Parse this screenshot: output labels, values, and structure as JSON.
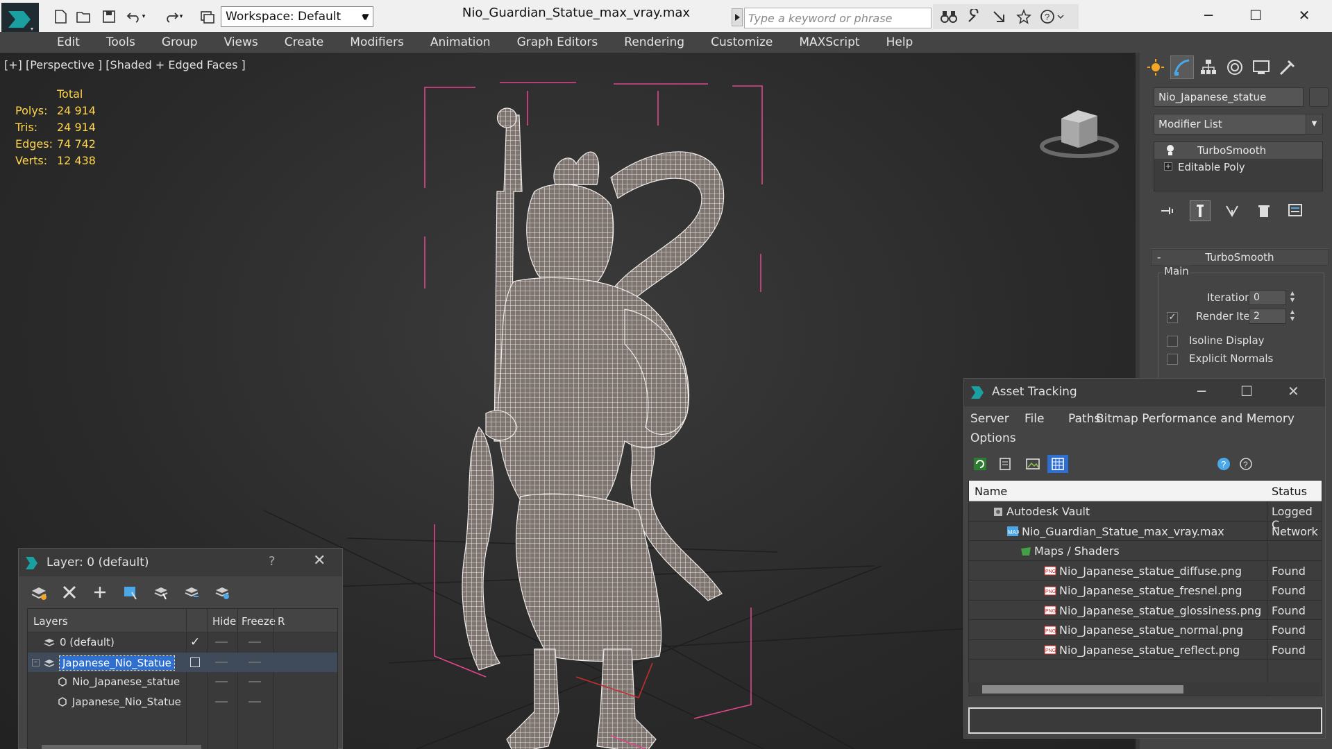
{
  "titlebar": {
    "workspace_label": "Workspace: Default",
    "document_title": "Nio_Guardian_Statue_max_vray.max",
    "search_placeholder": "Type a keyword or phrase"
  },
  "menu": [
    "Edit",
    "Tools",
    "Group",
    "Views",
    "Create",
    "Modifiers",
    "Animation",
    "Graph Editors",
    "Rendering",
    "Customize",
    "MAXScript",
    "Help"
  ],
  "viewport": {
    "label": "[+] [Perspective ] [Shaded + Edged Faces ]",
    "stats": {
      "header": "Total",
      "rows": [
        {
          "key": "Polys:",
          "value": "24 914"
        },
        {
          "key": "Tris:",
          "value": "24 914"
        },
        {
          "key": "Edges:",
          "value": "74 742"
        },
        {
          "key": "Verts:",
          "value": "12 438"
        }
      ]
    }
  },
  "command_panel": {
    "object_name": "Nio_Japanese_statue",
    "modifier_list": "Modifier List",
    "stack": [
      "TurboSmooth",
      "Editable Poly"
    ],
    "rollout_title": "TurboSmooth",
    "group_label": "Main",
    "iterations_label": "Iterations:",
    "iterations_value": "0",
    "render_iters_label": "Render Iters:",
    "render_iters_value": "2",
    "isoline_label": "Isoline Display",
    "explicit_normals_label": "Explicit Normals"
  },
  "asset_tracking": {
    "title": "Asset Tracking",
    "menu": [
      "Server",
      "File",
      "Paths",
      "Bitmap Performance and Memory",
      "Options"
    ],
    "columns": {
      "name": "Name",
      "status": "Status"
    },
    "rows": [
      {
        "name": "Autodesk Vault",
        "status": "Logged C",
        "indent": 0,
        "icon": "vault-icon"
      },
      {
        "name": "Nio_Guardian_Statue_max_vray.max",
        "status": "Network",
        "indent": 1,
        "icon": "max-file-icon"
      },
      {
        "name": "Maps / Shaders",
        "status": "",
        "indent": 2,
        "icon": "maps-folder-icon"
      },
      {
        "name": "Nio_Japanese_statue_diffuse.png",
        "status": "Found",
        "indent": 3,
        "icon": "png-icon"
      },
      {
        "name": "Nio_Japanese_statue_fresnel.png",
        "status": "Found",
        "indent": 3,
        "icon": "png-icon"
      },
      {
        "name": "Nio_Japanese_statue_glossiness.png",
        "status": "Found",
        "indent": 3,
        "icon": "png-icon"
      },
      {
        "name": "Nio_Japanese_statue_normal.png",
        "status": "Found",
        "indent": 3,
        "icon": "png-icon"
      },
      {
        "name": "Nio_Japanese_statue_reflect.png",
        "status": "Found",
        "indent": 3,
        "icon": "png-icon"
      }
    ]
  },
  "layer_window": {
    "title": "Layer: 0 (default)",
    "help": "?",
    "columns": {
      "layers": "Layers",
      "hide": "Hide",
      "freeze": "Freeze",
      "render": "R"
    },
    "rows": [
      {
        "name": "0 (default)",
        "type": "layer",
        "indent": 0,
        "current": true,
        "selected": false
      },
      {
        "name": "Japanese_Nio_Statue",
        "type": "layer",
        "indent": 0,
        "current": false,
        "selected": true
      },
      {
        "name": "Nio_Japanese_statue",
        "type": "object",
        "indent": 1,
        "current": false,
        "selected": false
      },
      {
        "name": "Japanese_Nio_Statue",
        "type": "object",
        "indent": 1,
        "current": false,
        "selected": false
      }
    ]
  },
  "colors": {
    "stats_yellow": "#ffd54a",
    "selection_blue": "#2f6fd0",
    "bbox_pink": "#e0468a"
  }
}
